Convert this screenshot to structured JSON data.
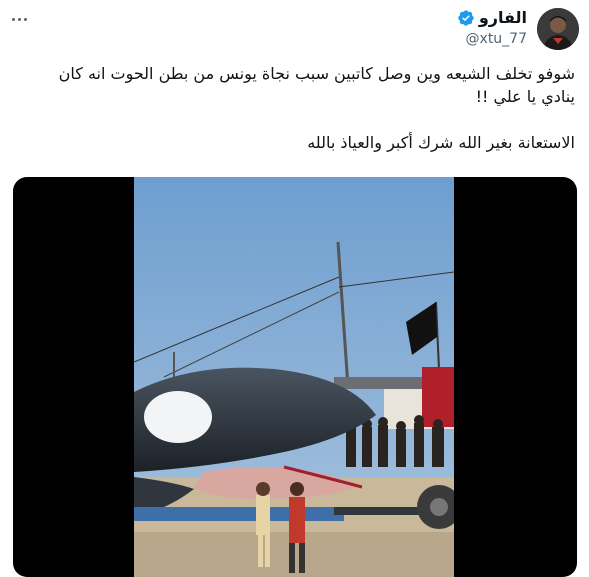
{
  "tweet": {
    "author": {
      "display_name": "الفارو",
      "handle": "@xtu_77",
      "verified": true
    },
    "text_lines": [
      "شوفو تخلف الشيعه وين وصل كاتبين سبب نجاة يونس من بطن الحوت انه كان",
      "ينادي يا علي !!",
      "الاستعانة بغير الله شرك أكبر والعياذ بالله"
    ],
    "media": {
      "type": "video"
    }
  },
  "icons": {
    "more": "more-horizontal-icon",
    "verified": "verified-badge-icon"
  },
  "colors": {
    "text": "#0f1419",
    "secondary": "#536471",
    "verified": "#1d9bf0"
  }
}
